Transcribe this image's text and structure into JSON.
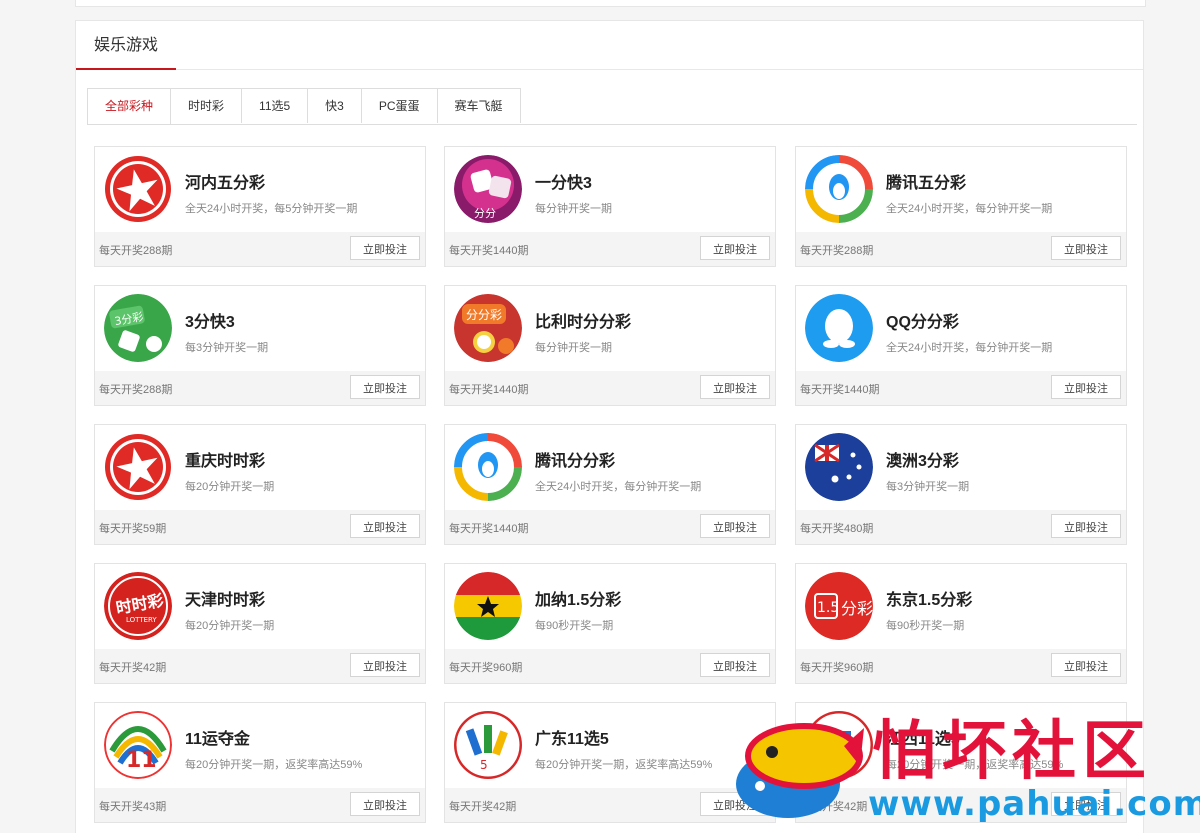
{
  "section": {
    "title": "娱乐游戏"
  },
  "tabs": [
    {
      "label": "全部彩种",
      "active": true
    },
    {
      "label": "时时彩"
    },
    {
      "label": "11选5"
    },
    {
      "label": "快3"
    },
    {
      "label": "PC蛋蛋"
    },
    {
      "label": "赛车飞艇"
    }
  ],
  "bet_label": "立即投注",
  "games": [
    {
      "name": "河内五分彩",
      "desc": "全天24小时开奖，每5分钟开奖一期",
      "count": "每天开奖288期",
      "icon": "star-red-icon"
    },
    {
      "name": "一分快3",
      "desc": "每分钟开奖一期",
      "count": "每天开奖1440期",
      "icon": "kuai3-pink-icon"
    },
    {
      "name": "腾讯五分彩",
      "desc": "全天24小时开奖，每分钟开奖一期",
      "count": "每天开奖288期",
      "icon": "tencent-icon"
    },
    {
      "name": "3分快3",
      "desc": "每3分钟开奖一期",
      "count": "每天开奖288期",
      "icon": "kuai3-green-icon"
    },
    {
      "name": "比利时分分彩",
      "desc": "每分钟开奖一期",
      "count": "每天开奖1440期",
      "icon": "fenfencai-icon"
    },
    {
      "name": "QQ分分彩",
      "desc": "全天24小时开奖，每分钟开奖一期",
      "count": "每天开奖1440期",
      "icon": "qq-penguin-icon"
    },
    {
      "name": "重庆时时彩",
      "desc": "每20分钟开奖一期",
      "count": "每天开奖59期",
      "icon": "star-red-icon"
    },
    {
      "name": "腾讯分分彩",
      "desc": "全天24小时开奖，每分钟开奖一期",
      "count": "每天开奖1440期",
      "icon": "tencent-icon"
    },
    {
      "name": "澳洲3分彩",
      "desc": "每3分钟开奖一期",
      "count": "每天开奖480期",
      "icon": "australia-flag-icon"
    },
    {
      "name": "天津时时彩",
      "desc": "每20分钟开奖一期",
      "count": "每天开奖42期",
      "icon": "lottery-red-icon"
    },
    {
      "name": "加纳1.5分彩",
      "desc": "每90秒开奖一期",
      "count": "每天开奖960期",
      "icon": "ghana-flag-icon"
    },
    {
      "name": "东京1.5分彩",
      "desc": "每90秒开奖一期",
      "count": "每天开奖960期",
      "icon": "tokyo-red-icon"
    },
    {
      "name": "11运夺金",
      "desc": "每20分钟开奖一期，返奖率高达59%",
      "count": "每天开奖43期",
      "icon": "11-colorful-icon"
    },
    {
      "name": "广东11选5",
      "desc": "每20分钟开奖一期，返奖率高达59%",
      "count": "每天开奖42期",
      "icon": "guangdong-11x5-icon"
    },
    {
      "name": "江西11选5",
      "desc": "每20分钟开奖一期，返奖率高达59%",
      "count": "每天开奖42期",
      "icon": "jiangxi-11x5-icon"
    }
  ],
  "watermark": {
    "text": "怕坏社区",
    "url": "www.pahuai.com"
  }
}
